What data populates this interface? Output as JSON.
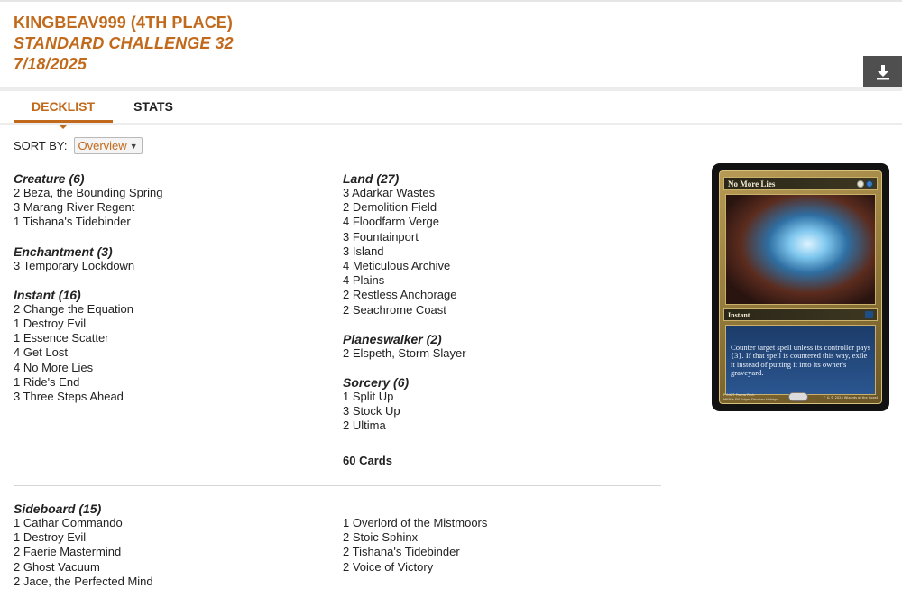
{
  "header": {
    "player": "KINGBEAV999 (4TH PLACE)",
    "event": "STANDARD CHALLENGE 32",
    "date": "7/18/2025"
  },
  "download_icon": "download-icon",
  "tabs": [
    {
      "label": "DECKLIST",
      "active": true
    },
    {
      "label": "STATS",
      "active": false
    }
  ],
  "sort": {
    "label": "SORT BY:",
    "selected": "Overview"
  },
  "left_column": [
    {
      "title": "Creature (6)",
      "cards": [
        "2 Beza, the Bounding Spring",
        "3 Marang River Regent",
        "1 Tishana's Tidebinder"
      ]
    },
    {
      "title": "Enchantment (3)",
      "cards": [
        "3 Temporary Lockdown"
      ]
    },
    {
      "title": "Instant (16)",
      "cards": [
        "2 Change the Equation",
        "1 Destroy Evil",
        "1 Essence Scatter",
        "4 Get Lost",
        "4 No More Lies",
        "1 Ride's End",
        "3 Three Steps Ahead"
      ]
    }
  ],
  "right_column": [
    {
      "title": "Land (27)",
      "cards": [
        "3 Adarkar Wastes",
        "2 Demolition Field",
        "4 Floodfarm Verge",
        "3 Fountainport",
        "3 Island",
        "4 Meticulous Archive",
        "4 Plains",
        "2 Restless Anchorage",
        "2 Seachrome Coast"
      ]
    },
    {
      "title": "Planeswalker (2)",
      "cards": [
        "2 Elspeth, Storm Slayer"
      ]
    },
    {
      "title": "Sorcery (6)",
      "cards": [
        "1 Split Up",
        "3 Stock Up",
        "2 Ultima"
      ]
    }
  ],
  "total": "60 Cards",
  "sideboard": {
    "title": "Sideboard (15)",
    "col1": [
      "1 Cathar Commando",
      "1 Destroy Evil",
      "2 Faerie Mastermind",
      "2 Ghost Vacuum",
      "2 Jace, the Perfected Mind"
    ],
    "col2": [
      "1 Overlord of the Mistmoors",
      "2 Stoic Sphinx",
      "2 Tishana's Tidebinder",
      "2 Voice of Victory"
    ]
  },
  "card_preview": {
    "name": "No More Lies",
    "type": "Instant",
    "rules": "Counter target spell unless its controller pays {3}. If that spell is countered this way, exile it instead of putting it into its owner's graveyard.",
    "footer_left_1": "P 0427   Promo Pack",
    "footer_left_2": "MKM • EN  Edgar Sánchez Hidalgo",
    "footer_right": "™ & © 2024 Wizards of the Coast",
    "mana_colors": [
      "#e8e4d0",
      "#3b7cc4"
    ]
  },
  "colors": {
    "accent": "#c26a1c",
    "download_bg": "#4f4f4f"
  }
}
